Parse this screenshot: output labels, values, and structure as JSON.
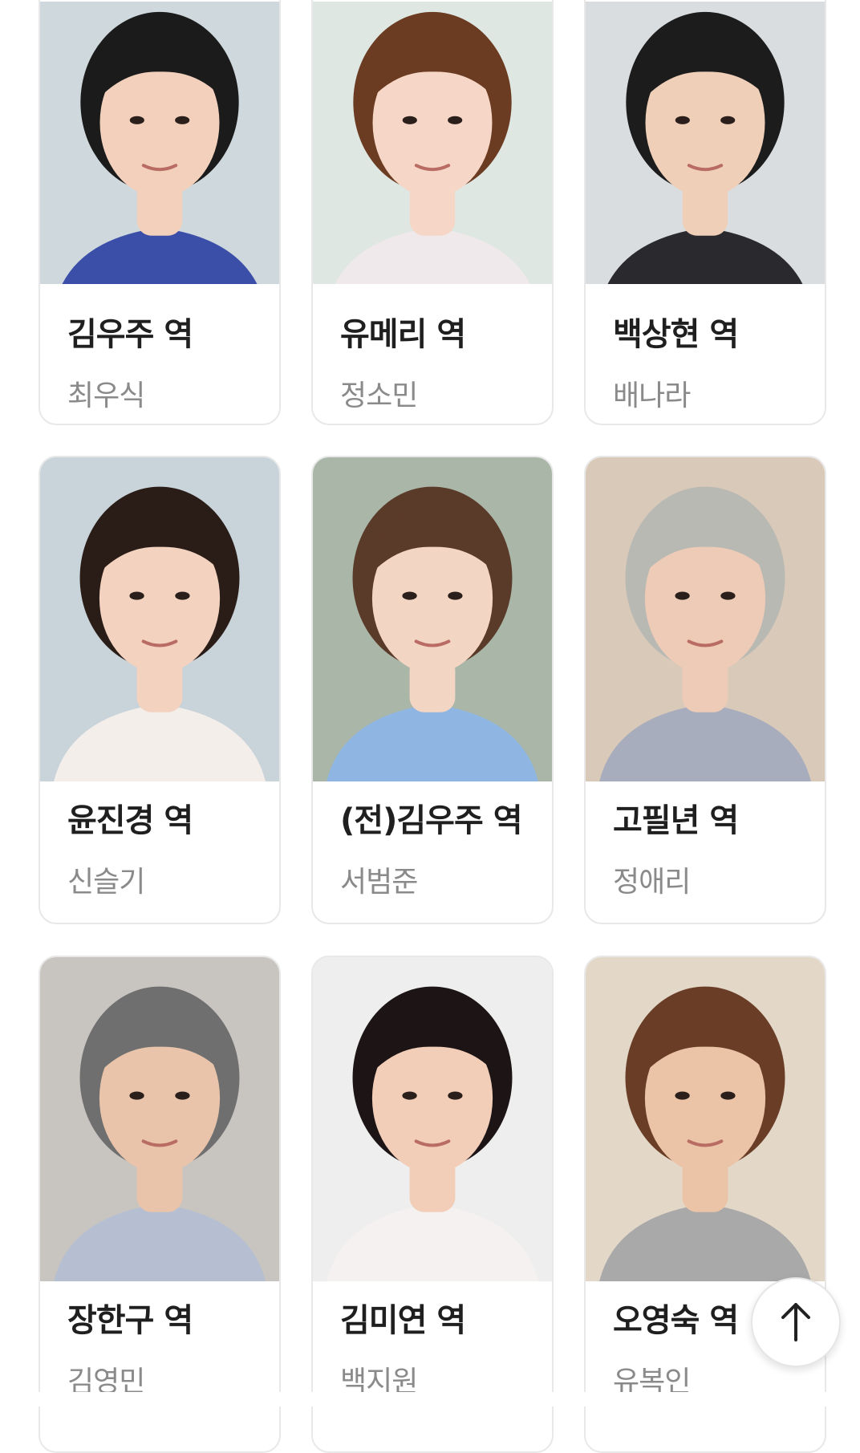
{
  "cast": [
    {
      "role": "김우주 역",
      "actor": "최우식",
      "photo_bg": "#cfd8dc",
      "skin": "#f2d0bc",
      "hair": "#1b1b1b",
      "cloth": "#3b4fa8"
    },
    {
      "role": "유메리 역",
      "actor": "정소민",
      "photo_bg": "#dfe7e2",
      "skin": "#f6d6c6",
      "hair": "#6b3b22",
      "cloth": "#f0e9ec"
    },
    {
      "role": "백상현 역",
      "actor": "배나라",
      "photo_bg": "#d9dde0",
      "skin": "#efcfb8",
      "hair": "#1c1c1c",
      "cloth": "#2a2a2e"
    },
    {
      "role": "윤진경 역",
      "actor": "신슬기",
      "photo_bg": "#c9d3da",
      "skin": "#f3d3c0",
      "hair": "#2a1d18",
      "cloth": "#f3eeea"
    },
    {
      "role": "(전)김우주 역",
      "actor": "서범준",
      "photo_bg": "#a9b6a8",
      "skin": "#f3d5c3",
      "hair": "#5a3a28",
      "cloth": "#8fb6e3"
    },
    {
      "role": "고필년 역",
      "actor": "정애리",
      "photo_bg": "#d9c9b9",
      "skin": "#eecbb6",
      "hair": "#b9b9b4",
      "cloth": "#a8adbd"
    },
    {
      "role": "장한구 역",
      "actor": "김영민",
      "photo_bg": "#c8c4c0",
      "skin": "#e9c4aa",
      "hair": "#6f6f6f",
      "cloth": "#b6bfd1"
    },
    {
      "role": "김미연 역",
      "actor": "백지원",
      "photo_bg": "#eeeeee",
      "skin": "#f2cdb8",
      "hair": "#1d1515",
      "cloth": "#f4f1f0"
    },
    {
      "role": "오영숙 역",
      "actor": "유복인",
      "photo_bg": "#e3d7c8",
      "skin": "#ebc3a6",
      "hair": "#6a3e26",
      "cloth": "#a9a9a9"
    }
  ],
  "scroll_top_button": {
    "icon": "arrow-up-icon"
  }
}
